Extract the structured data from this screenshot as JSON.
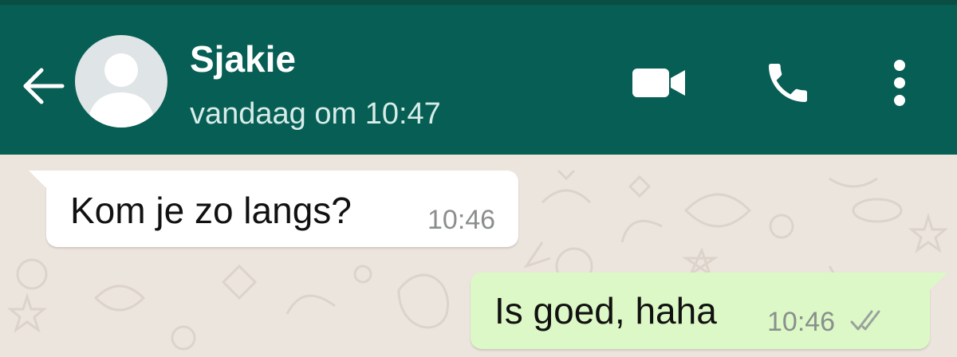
{
  "header": {
    "contact_name": "Sjakie",
    "last_seen": "vandaag om 10:47",
    "back_icon": "arrow-left-icon",
    "avatar_icon": "default-avatar-icon",
    "actions": [
      {
        "id": "video",
        "icon": "video-camera-icon"
      },
      {
        "id": "call",
        "icon": "phone-icon"
      },
      {
        "id": "menu",
        "icon": "more-vertical-icon"
      }
    ]
  },
  "messages": [
    {
      "direction": "incoming",
      "text": "Kom je zo langs?",
      "time": "10:46"
    },
    {
      "direction": "outgoing",
      "text": "Is goed, haha",
      "time": "10:46",
      "status": "delivered",
      "status_icon": "double-check-icon"
    }
  ],
  "colors": {
    "header": "#075e54",
    "chat_background": "#ece5dd",
    "incoming_bubble": "#ffffff",
    "outgoing_bubble": "#dcf8c6"
  }
}
